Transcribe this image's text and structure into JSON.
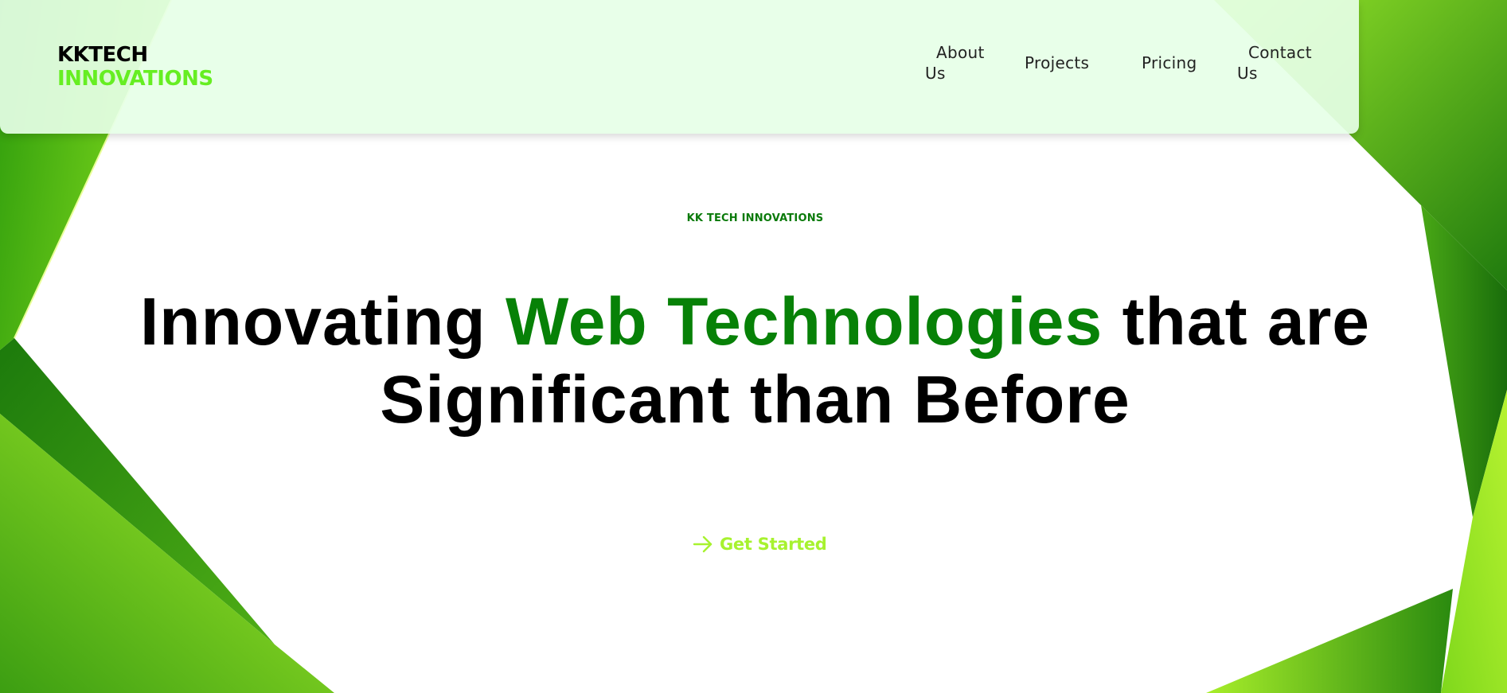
{
  "brand": {
    "line1": "KKTECH",
    "line2": "INNOVATIONS"
  },
  "nav": {
    "items": [
      {
        "label": "About Us"
      },
      {
        "label": "Projects"
      },
      {
        "label": "Pricing"
      },
      {
        "label": "Contact Us"
      }
    ]
  },
  "hero": {
    "eyebrow": "KK TECH INNOVATIONS",
    "headline_part1": "Innovating ",
    "headline_highlight": "Web Technologies",
    "headline_part2": " that are Significant than Before",
    "cta_label": "Get Started",
    "cta_icon": "arrow-right-icon"
  },
  "colors": {
    "accent_green": "#078107",
    "lime": "#a7f22f",
    "logo_green": "#66ee22",
    "nav_bg": "#e6ffe7",
    "dark_green": "#166d0b"
  }
}
